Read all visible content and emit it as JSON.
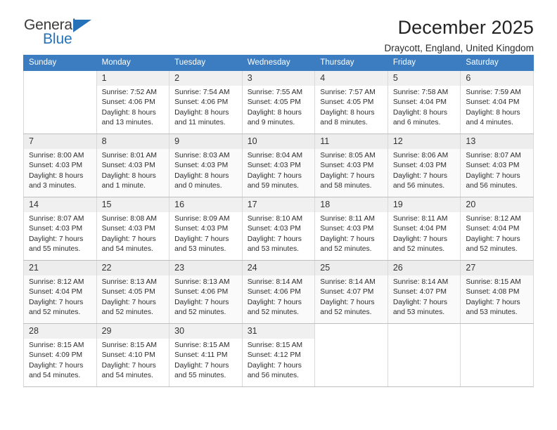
{
  "brand": {
    "word1": "General",
    "word2": "Blue",
    "triangle_color": "#2572b8"
  },
  "header": {
    "title": "December 2025",
    "subtitle": "Draycott, England, United Kingdom"
  },
  "theme": {
    "header_row_bg": "#3b7dc0",
    "header_row_text": "#ffffff",
    "daynum_bg": "#f0f0f0",
    "alt_row_bg": "#fafafa"
  },
  "weekdays": [
    "Sunday",
    "Monday",
    "Tuesday",
    "Wednesday",
    "Thursday",
    "Friday",
    "Saturday"
  ],
  "weeks": [
    [
      {
        "day": "",
        "sunrise": "",
        "sunset": "",
        "daylight_line1": "",
        "daylight_line2": ""
      },
      {
        "day": "1",
        "sunrise": "Sunrise: 7:52 AM",
        "sunset": "Sunset: 4:06 PM",
        "daylight_line1": "Daylight: 8 hours",
        "daylight_line2": "and 13 minutes."
      },
      {
        "day": "2",
        "sunrise": "Sunrise: 7:54 AM",
        "sunset": "Sunset: 4:06 PM",
        "daylight_line1": "Daylight: 8 hours",
        "daylight_line2": "and 11 minutes."
      },
      {
        "day": "3",
        "sunrise": "Sunrise: 7:55 AM",
        "sunset": "Sunset: 4:05 PM",
        "daylight_line1": "Daylight: 8 hours",
        "daylight_line2": "and 9 minutes."
      },
      {
        "day": "4",
        "sunrise": "Sunrise: 7:57 AM",
        "sunset": "Sunset: 4:05 PM",
        "daylight_line1": "Daylight: 8 hours",
        "daylight_line2": "and 8 minutes."
      },
      {
        "day": "5",
        "sunrise": "Sunrise: 7:58 AM",
        "sunset": "Sunset: 4:04 PM",
        "daylight_line1": "Daylight: 8 hours",
        "daylight_line2": "and 6 minutes."
      },
      {
        "day": "6",
        "sunrise": "Sunrise: 7:59 AM",
        "sunset": "Sunset: 4:04 PM",
        "daylight_line1": "Daylight: 8 hours",
        "daylight_line2": "and 4 minutes."
      }
    ],
    [
      {
        "day": "7",
        "sunrise": "Sunrise: 8:00 AM",
        "sunset": "Sunset: 4:03 PM",
        "daylight_line1": "Daylight: 8 hours",
        "daylight_line2": "and 3 minutes."
      },
      {
        "day": "8",
        "sunrise": "Sunrise: 8:01 AM",
        "sunset": "Sunset: 4:03 PM",
        "daylight_line1": "Daylight: 8 hours",
        "daylight_line2": "and 1 minute."
      },
      {
        "day": "9",
        "sunrise": "Sunrise: 8:03 AM",
        "sunset": "Sunset: 4:03 PM",
        "daylight_line1": "Daylight: 8 hours",
        "daylight_line2": "and 0 minutes."
      },
      {
        "day": "10",
        "sunrise": "Sunrise: 8:04 AM",
        "sunset": "Sunset: 4:03 PM",
        "daylight_line1": "Daylight: 7 hours",
        "daylight_line2": "and 59 minutes."
      },
      {
        "day": "11",
        "sunrise": "Sunrise: 8:05 AM",
        "sunset": "Sunset: 4:03 PM",
        "daylight_line1": "Daylight: 7 hours",
        "daylight_line2": "and 58 minutes."
      },
      {
        "day": "12",
        "sunrise": "Sunrise: 8:06 AM",
        "sunset": "Sunset: 4:03 PM",
        "daylight_line1": "Daylight: 7 hours",
        "daylight_line2": "and 56 minutes."
      },
      {
        "day": "13",
        "sunrise": "Sunrise: 8:07 AM",
        "sunset": "Sunset: 4:03 PM",
        "daylight_line1": "Daylight: 7 hours",
        "daylight_line2": "and 56 minutes."
      }
    ],
    [
      {
        "day": "14",
        "sunrise": "Sunrise: 8:07 AM",
        "sunset": "Sunset: 4:03 PM",
        "daylight_line1": "Daylight: 7 hours",
        "daylight_line2": "and 55 minutes."
      },
      {
        "day": "15",
        "sunrise": "Sunrise: 8:08 AM",
        "sunset": "Sunset: 4:03 PM",
        "daylight_line1": "Daylight: 7 hours",
        "daylight_line2": "and 54 minutes."
      },
      {
        "day": "16",
        "sunrise": "Sunrise: 8:09 AM",
        "sunset": "Sunset: 4:03 PM",
        "daylight_line1": "Daylight: 7 hours",
        "daylight_line2": "and 53 minutes."
      },
      {
        "day": "17",
        "sunrise": "Sunrise: 8:10 AM",
        "sunset": "Sunset: 4:03 PM",
        "daylight_line1": "Daylight: 7 hours",
        "daylight_line2": "and 53 minutes."
      },
      {
        "day": "18",
        "sunrise": "Sunrise: 8:11 AM",
        "sunset": "Sunset: 4:03 PM",
        "daylight_line1": "Daylight: 7 hours",
        "daylight_line2": "and 52 minutes."
      },
      {
        "day": "19",
        "sunrise": "Sunrise: 8:11 AM",
        "sunset": "Sunset: 4:04 PM",
        "daylight_line1": "Daylight: 7 hours",
        "daylight_line2": "and 52 minutes."
      },
      {
        "day": "20",
        "sunrise": "Sunrise: 8:12 AM",
        "sunset": "Sunset: 4:04 PM",
        "daylight_line1": "Daylight: 7 hours",
        "daylight_line2": "and 52 minutes."
      }
    ],
    [
      {
        "day": "21",
        "sunrise": "Sunrise: 8:12 AM",
        "sunset": "Sunset: 4:04 PM",
        "daylight_line1": "Daylight: 7 hours",
        "daylight_line2": "and 52 minutes."
      },
      {
        "day": "22",
        "sunrise": "Sunrise: 8:13 AM",
        "sunset": "Sunset: 4:05 PM",
        "daylight_line1": "Daylight: 7 hours",
        "daylight_line2": "and 52 minutes."
      },
      {
        "day": "23",
        "sunrise": "Sunrise: 8:13 AM",
        "sunset": "Sunset: 4:06 PM",
        "daylight_line1": "Daylight: 7 hours",
        "daylight_line2": "and 52 minutes."
      },
      {
        "day": "24",
        "sunrise": "Sunrise: 8:14 AM",
        "sunset": "Sunset: 4:06 PM",
        "daylight_line1": "Daylight: 7 hours",
        "daylight_line2": "and 52 minutes."
      },
      {
        "day": "25",
        "sunrise": "Sunrise: 8:14 AM",
        "sunset": "Sunset: 4:07 PM",
        "daylight_line1": "Daylight: 7 hours",
        "daylight_line2": "and 52 minutes."
      },
      {
        "day": "26",
        "sunrise": "Sunrise: 8:14 AM",
        "sunset": "Sunset: 4:07 PM",
        "daylight_line1": "Daylight: 7 hours",
        "daylight_line2": "and 53 minutes."
      },
      {
        "day": "27",
        "sunrise": "Sunrise: 8:15 AM",
        "sunset": "Sunset: 4:08 PM",
        "daylight_line1": "Daylight: 7 hours",
        "daylight_line2": "and 53 minutes."
      }
    ],
    [
      {
        "day": "28",
        "sunrise": "Sunrise: 8:15 AM",
        "sunset": "Sunset: 4:09 PM",
        "daylight_line1": "Daylight: 7 hours",
        "daylight_line2": "and 54 minutes."
      },
      {
        "day": "29",
        "sunrise": "Sunrise: 8:15 AM",
        "sunset": "Sunset: 4:10 PM",
        "daylight_line1": "Daylight: 7 hours",
        "daylight_line2": "and 54 minutes."
      },
      {
        "day": "30",
        "sunrise": "Sunrise: 8:15 AM",
        "sunset": "Sunset: 4:11 PM",
        "daylight_line1": "Daylight: 7 hours",
        "daylight_line2": "and 55 minutes."
      },
      {
        "day": "31",
        "sunrise": "Sunrise: 8:15 AM",
        "sunset": "Sunset: 4:12 PM",
        "daylight_line1": "Daylight: 7 hours",
        "daylight_line2": "and 56 minutes."
      },
      {
        "day": "",
        "sunrise": "",
        "sunset": "",
        "daylight_line1": "",
        "daylight_line2": ""
      },
      {
        "day": "",
        "sunrise": "",
        "sunset": "",
        "daylight_line1": "",
        "daylight_line2": ""
      },
      {
        "day": "",
        "sunrise": "",
        "sunset": "",
        "daylight_line1": "",
        "daylight_line2": ""
      }
    ]
  ]
}
